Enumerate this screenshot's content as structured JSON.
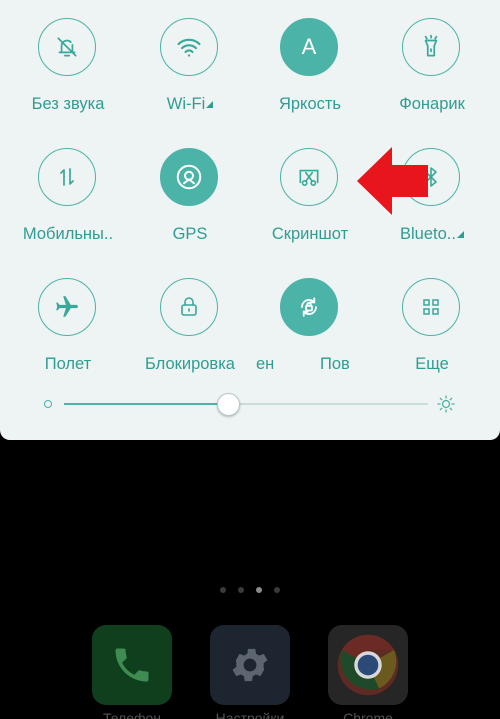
{
  "tiles": [
    {
      "label": "Без звука",
      "icon": "bell-off-icon",
      "active": false
    },
    {
      "label": "Wi-Fi",
      "icon": "wifi-icon",
      "active": false
    },
    {
      "label": "Яркость",
      "icon": "auto-brightness-icon",
      "glyph": "A",
      "active": true
    },
    {
      "label": "Фонарик",
      "icon": "flashlight-icon",
      "active": false
    },
    {
      "label": "Мобильны..",
      "icon": "mobile-data-icon",
      "active": false
    },
    {
      "label": "GPS",
      "icon": "location-icon",
      "active": true
    },
    {
      "label": "Скриншот",
      "icon": "screenshot-icon",
      "active": false
    },
    {
      "label": "Blueto..",
      "icon": "bluetooth-icon",
      "active": false
    },
    {
      "label": "Полет",
      "icon": "airplane-icon",
      "active": false
    },
    {
      "label": "Блокировка",
      "icon": "lock-icon",
      "active": false
    },
    {
      "label": "ен",
      "icon": "",
      "active": false
    },
    {
      "label": "Пов",
      "icon": "rotation-icon",
      "active": true
    },
    {
      "label": "Еще",
      "icon": "grid-icon",
      "active": false
    }
  ],
  "brightness": {
    "level": 0.45
  },
  "colors": {
    "accent": "#4bb3a7",
    "panel": "#eef3f3",
    "annotation": "#e8161c"
  },
  "home": {
    "page_dots": 4,
    "current_page": 3,
    "dock": [
      {
        "icon": "phone-icon",
        "label": "Телефон"
      },
      {
        "icon": "settings-gear-icon",
        "label": "Настройки"
      },
      {
        "icon": "chrome-icon",
        "label": "Chrome"
      }
    ]
  }
}
